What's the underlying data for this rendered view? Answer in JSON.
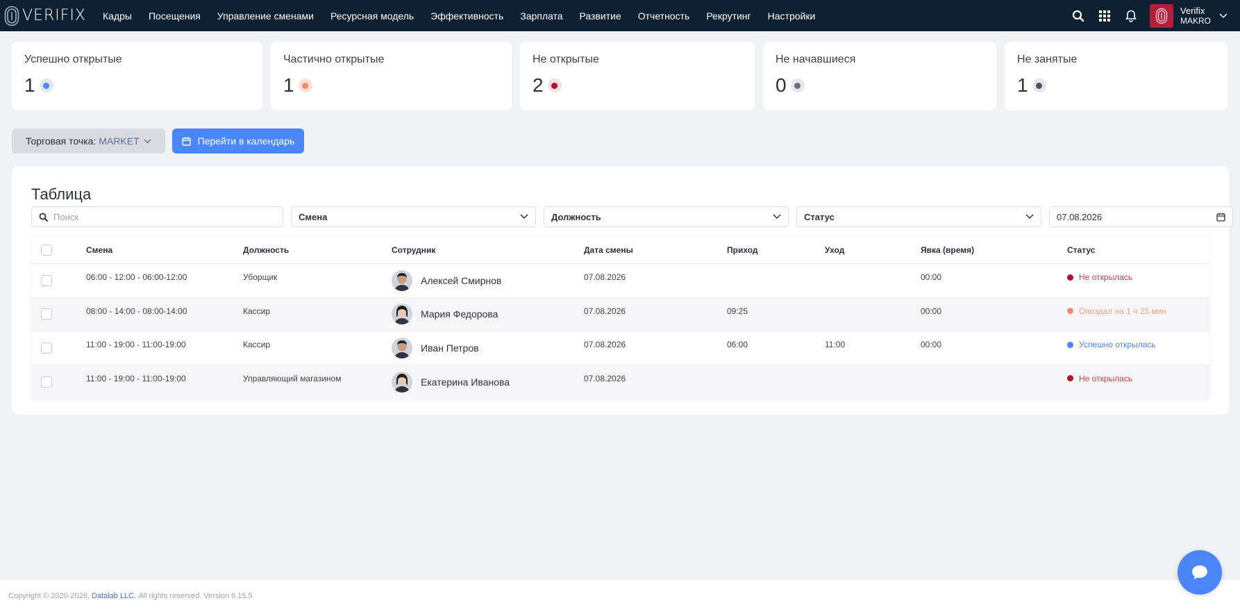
{
  "brand": {
    "logo_text": "VERIFIX"
  },
  "nav": {
    "items": [
      {
        "label": "Кадры"
      },
      {
        "label": "Посещения"
      },
      {
        "label": "Управление сменами"
      },
      {
        "label": "Ресурсная модель"
      },
      {
        "label": "Эффективность"
      },
      {
        "label": "Зарплата"
      },
      {
        "label": "Развитие"
      },
      {
        "label": "Отчетность"
      },
      {
        "label": "Рекрутинг"
      },
      {
        "label": "Настройки"
      }
    ],
    "icons": [
      "search-icon",
      "apps-grid-icon",
      "bell-icon",
      "fingerprint-icon"
    ],
    "user": {
      "name": "Verifix",
      "org": "MAKRO"
    }
  },
  "stats": [
    {
      "label": "Успешно открытые",
      "value": "1",
      "color": "#4a86f7",
      "ring": "#e3e7ef"
    },
    {
      "label": "Частично открытые",
      "value": "1",
      "color": "#f28b6e",
      "ring": "#fbe1d9"
    },
    {
      "label": "Не открытые",
      "value": "2",
      "color": "#b3102e",
      "ring": "#f6dfe2"
    },
    {
      "label": "Не начавшиеся",
      "value": "0",
      "color": "#6b7180",
      "ring": "#e6e7ea"
    },
    {
      "label": "Не занятые",
      "value": "1",
      "color": "#4d5361",
      "ring": "#e6e7ea"
    }
  ],
  "toolbar": {
    "store_label": "Торговая точка:",
    "store_value": "MARKET",
    "calendar_button": "Перейти в календарь"
  },
  "table": {
    "title": "Таблица",
    "search_placeholder": "Поиск",
    "filters": {
      "shift": "Смена",
      "position": "Должность",
      "status": "Статус",
      "date": "07.08.2026"
    },
    "columns": {
      "shift": "Смена",
      "position": "Должность",
      "employee": "Сотрудник",
      "date": "Дата смены",
      "arrival": "Приход",
      "departure": "Уход",
      "attendance": "Явка (время)",
      "status": "Статус"
    },
    "rows": [
      {
        "shift": "06:00 - 12:00 - 06:00-12:00",
        "position": "Уборщик",
        "employee": "Алексей Смирнов",
        "date": "07.08.2026",
        "arrival": "",
        "departure": "",
        "attendance": "00:00",
        "status": "Не открылась",
        "status_color": "#b3102e",
        "text_color": "#d33a3a",
        "avatar": "male"
      },
      {
        "shift": "08:00 - 14:00 - 08:00-14:00",
        "position": "Кассир",
        "employee": "Мария Федорова",
        "date": "07.08.2026",
        "arrival": "09:25",
        "departure": "",
        "attendance": "00:00",
        "status": "Опоздал на 1 ч 25 мин",
        "status_color": "#f28b6e",
        "text_color": "#f0a07f",
        "avatar": "female"
      },
      {
        "shift": "11:00 - 19:00 - 11:00-19:00",
        "position": "Кассир",
        "employee": "Иван Петров",
        "date": "07.08.2026",
        "arrival": "06:00",
        "departure": "11:00",
        "attendance": "00:00",
        "status": "Успешно открылась",
        "status_color": "#4a86f7",
        "text_color": "#4a86f7",
        "avatar": "male"
      },
      {
        "shift": "11:00 - 19:00 - 11:00-19:00",
        "position": "Управляющий магазином",
        "employee": "Екатерина Иванова",
        "date": "07.08.2026",
        "arrival": "",
        "departure": "",
        "attendance": "",
        "status": "Не открылась",
        "status_color": "#b3102e",
        "text_color": "#d33a3a",
        "avatar": "female"
      }
    ]
  },
  "footer": {
    "prefix": "Copyright © 2020-2026,",
    "company": "Datalab LLC.",
    "suffix": "All rights reserved. Version 6.15.5"
  }
}
